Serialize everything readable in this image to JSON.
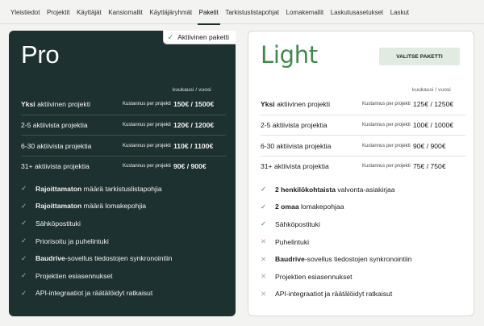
{
  "nav": {
    "tabs": [
      {
        "label": "Yleistiedot"
      },
      {
        "label": "Projektit"
      },
      {
        "label": "Käyttäjät"
      },
      {
        "label": "Kansiomallit"
      },
      {
        "label": "Käyttäjäryhmät"
      },
      {
        "label": "Paketit"
      },
      {
        "label": "Tarkistuslistapohjat"
      },
      {
        "label": "Lomakemallit"
      },
      {
        "label": "Laskutusasetukset"
      },
      {
        "label": "Laskut"
      }
    ],
    "active_tab": "Paketit"
  },
  "pro": {
    "name": "Pro",
    "active_badge": "Aktiivinen paketti",
    "period": "kuukausi / vuosi",
    "cost_label": "Kustannus per projekti",
    "rows": [
      {
        "bold": "Yksi",
        "rest": " aktiivinen projekti",
        "price": "150€ / 1500€"
      },
      {
        "bold": "",
        "rest": "2-5 aktiivista projektia",
        "price": "120€ / 1200€"
      },
      {
        "bold": "",
        "rest": "6-30 aktiivista projektia",
        "price": "110€ / 1100€"
      },
      {
        "bold": "",
        "rest": "31+ aktiivista projektia",
        "price": "90€ / 900€"
      }
    ],
    "features": [
      {
        "bold": "Rajoittamaton",
        "rest": " määrä tarkistuslistapohjia"
      },
      {
        "bold": "Rajoittamaton",
        "rest": " määrä lomakepohjia"
      },
      {
        "bold": "",
        "rest": "Sähköpostituki"
      },
      {
        "bold": "",
        "rest": "Priorisoitu ja puhelintuki"
      },
      {
        "bold": "Baudrive",
        "rest": "-sovellus tiedostojen synkronointiin"
      },
      {
        "bold": "",
        "rest": "Projektien esiasennukset"
      },
      {
        "bold": "",
        "rest": "API-integraatiot ja räätälöidyt ratkaisut"
      }
    ]
  },
  "light": {
    "name": "Light",
    "select_button": "VALITSE PAKETTI",
    "period": "kuukausi / vuosi",
    "cost_label": "Kustannus per projekti",
    "rows": [
      {
        "bold": "Yksi",
        "rest": " aktiivinen projekti",
        "price": "125€ / 1250€"
      },
      {
        "bold": "",
        "rest": "2-5 aktiivista projektia",
        "price": "100€ / 1000€"
      },
      {
        "bold": "",
        "rest": "6-30 aktiivista projektia",
        "price": "90€ / 900€"
      },
      {
        "bold": "",
        "rest": "31+ aktiivista projektia",
        "price": "75€ / 750€"
      }
    ],
    "features": [
      {
        "included": true,
        "bold": "2 henkilökohtaista",
        "rest": " valvonta-asiakirjaa"
      },
      {
        "included": true,
        "bold": "2 omaa",
        "rest": " lomakepohjaa"
      },
      {
        "included": true,
        "bold": "",
        "rest": "Sähköpostituki"
      },
      {
        "included": false,
        "bold": "",
        "rest": "Puhelintuki"
      },
      {
        "included": false,
        "bold": "Baudrive",
        "rest": "-sovellus tiedostojen synkronointiin"
      },
      {
        "included": false,
        "bold": "",
        "rest": "Projektien esiasennukset"
      },
      {
        "included": false,
        "bold": "",
        "rest": "API-integraatiot ja räätälöidyt ratkaisut"
      }
    ]
  }
}
